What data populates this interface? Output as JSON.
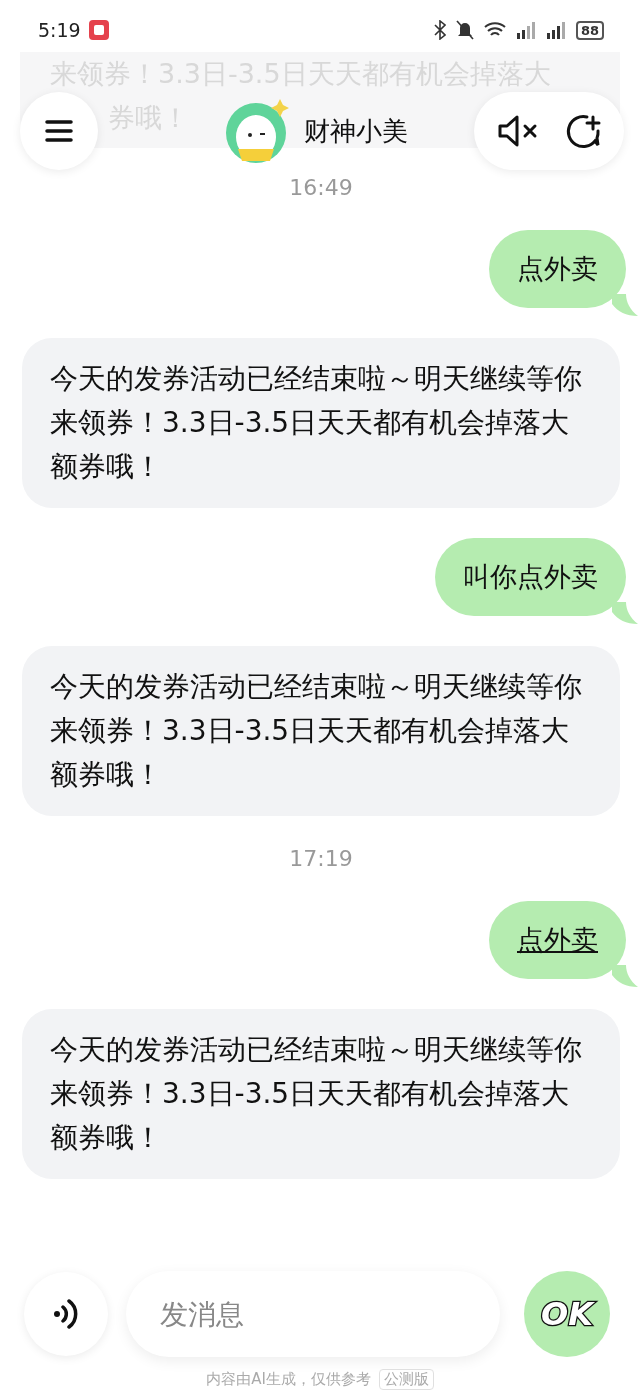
{
  "status_bar": {
    "time": "5:19",
    "battery": "88"
  },
  "scrolled_message": {
    "lines": [
      "来领券！3.3日-3.5日天天都有机会掉落大",
      "券哦！"
    ]
  },
  "header": {
    "title": "财神小美"
  },
  "messages": [
    {
      "kind": "time",
      "text": "16:49"
    },
    {
      "kind": "user",
      "text": "点外卖",
      "underlined": false
    },
    {
      "kind": "bot",
      "text": "今天的发券活动已经结束啦～明天继续等你来领券！3.3日-3.5日天天都有机会掉落大额券哦！"
    },
    {
      "kind": "user",
      "text": "叫你点外卖",
      "underlined": false
    },
    {
      "kind": "bot",
      "text": "今天的发券活动已经结束啦～明天继续等你来领券！3.3日-3.5日天天都有机会掉落大额券哦！"
    },
    {
      "kind": "time",
      "text": "17:19"
    },
    {
      "kind": "user",
      "text": "点外卖",
      "underlined": true
    },
    {
      "kind": "bot",
      "text": "今天的发券活动已经结束啦～明天继续等你来领券！3.3日-3.5日天天都有机会掉落大额券哦！"
    }
  ],
  "composer": {
    "placeholder": "发消息",
    "send_label": "OK"
  },
  "footer": {
    "note": "内容由AI生成，仅供参考",
    "badge": "公测版"
  }
}
